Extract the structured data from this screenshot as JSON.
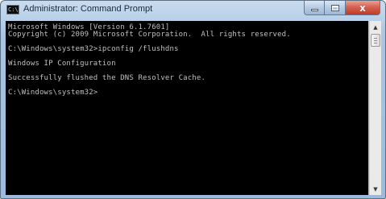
{
  "window": {
    "title": "Administrator: Command Prompt",
    "icon_label": "C:\\",
    "icon": "cmd-icon"
  },
  "controls": {
    "minimize_icon": "minimize-icon",
    "maximize_icon": "maximize-icon",
    "close_icon": "close-icon",
    "close_glyph": "x"
  },
  "console": {
    "lines": [
      "Microsoft Windows [Version 6.1.7601]",
      "Copyright (c) 2009 Microsoft Corporation.  All rights reserved.",
      "",
      "C:\\Windows\\system32>ipconfig /flushdns",
      "",
      "Windows IP Configuration",
      "",
      "Successfully flushed the DNS Resolver Cache.",
      "",
      "C:\\Windows\\system32>"
    ]
  },
  "scrollbar": {
    "up_arrow": "▲",
    "down_arrow": "▼"
  },
  "colors": {
    "console_background": "#000000",
    "console_text": "#c0c0c0",
    "close_button": "#c13a22"
  }
}
